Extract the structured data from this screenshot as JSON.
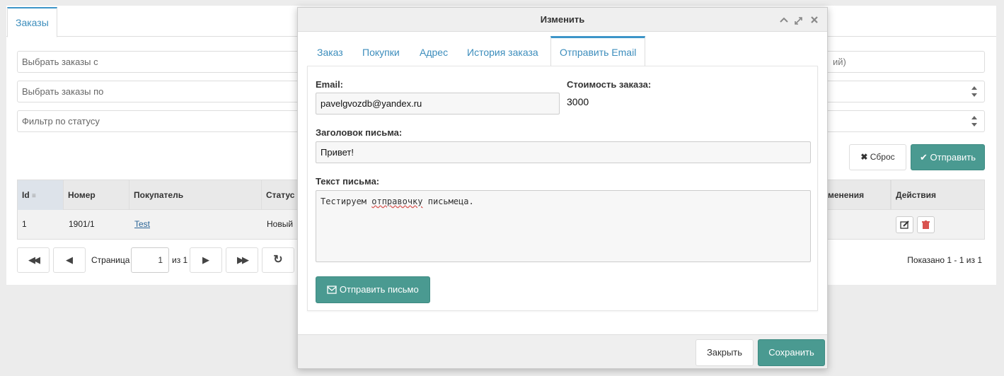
{
  "background": {
    "tab_label": "Заказы",
    "filters": {
      "from_placeholder": "Выбрать заказы с",
      "from_right_fragment": "ий)",
      "to_placeholder": "Выбрать заказы по",
      "status_placeholder": "Фильтр по статусу"
    },
    "reset_label": "Сброс",
    "submit_label": "Отправить",
    "grid": {
      "columns": [
        "Id",
        "Номер",
        "Покупатель",
        "Статус",
        "менения",
        "Действия"
      ],
      "rows": [
        {
          "id": "1",
          "number": "1901/1",
          "customer": "Test",
          "status": "Новый"
        }
      ]
    },
    "pager": {
      "page_label": "Страница",
      "page_value": "1",
      "of_label": "из 1",
      "shown": "Показано 1 - 1 из 1"
    }
  },
  "modal": {
    "title": "Изменить",
    "tabs": [
      "Заказ",
      "Покупки",
      "Адрес",
      "История заказа",
      "Отправить Email"
    ],
    "active_tab": "Отправить Email",
    "email_label": "Email:",
    "email_value": "pavelgvozdb@yandex.ru",
    "cost_label": "Стоимость заказа:",
    "cost_value": "3000",
    "subject_label": "Заголовок письма:",
    "subject_value": "Привет!",
    "body_label": "Текст письма:",
    "body_before": "Тестируем ",
    "body_misspelled": "отправочку",
    "body_after": " письмеца.",
    "send_mail_label": "Отправить письмо",
    "close_label": "Закрыть",
    "save_label": "Сохранить"
  },
  "colors": {
    "accent": "#3c8dbc",
    "primary_button": "#4a9a91",
    "background": "#ececec"
  }
}
